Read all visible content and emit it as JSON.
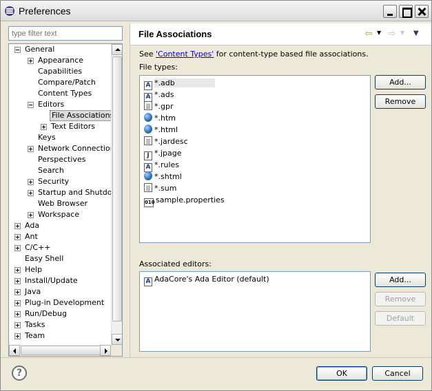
{
  "window": {
    "title": "Preferences"
  },
  "filter": {
    "placeholder": "type filter text"
  },
  "tree": [
    {
      "label": "General",
      "expander": "minus",
      "depth": 0
    },
    {
      "label": "Appearance",
      "expander": "plus",
      "depth": 1
    },
    {
      "label": "Capabilities",
      "expander": "none",
      "depth": 1
    },
    {
      "label": "Compare/Patch",
      "expander": "none",
      "depth": 1
    },
    {
      "label": "Content Types",
      "expander": "none",
      "depth": 1
    },
    {
      "label": "Editors",
      "expander": "minus",
      "depth": 1
    },
    {
      "label": "File Associations",
      "expander": "none",
      "depth": 2,
      "selected": true
    },
    {
      "label": "Text Editors",
      "expander": "plus",
      "depth": 2
    },
    {
      "label": "Keys",
      "expander": "none",
      "depth": 1
    },
    {
      "label": "Network Connections",
      "expander": "plus",
      "depth": 1
    },
    {
      "label": "Perspectives",
      "expander": "none",
      "depth": 1
    },
    {
      "label": "Search",
      "expander": "none",
      "depth": 1
    },
    {
      "label": "Security",
      "expander": "plus",
      "depth": 1
    },
    {
      "label": "Startup and Shutdown",
      "expander": "plus",
      "depth": 1
    },
    {
      "label": "Web Browser",
      "expander": "none",
      "depth": 1
    },
    {
      "label": "Workspace",
      "expander": "plus",
      "depth": 1
    },
    {
      "label": "Ada",
      "expander": "plus",
      "depth": 0
    },
    {
      "label": "Ant",
      "expander": "plus",
      "depth": 0
    },
    {
      "label": "C/C++",
      "expander": "plus",
      "depth": 0
    },
    {
      "label": "Easy Shell",
      "expander": "none",
      "depth": 0
    },
    {
      "label": "Help",
      "expander": "plus",
      "depth": 0
    },
    {
      "label": "Install/Update",
      "expander": "plus",
      "depth": 0
    },
    {
      "label": "Java",
      "expander": "plus",
      "depth": 0
    },
    {
      "label": "Plug-in Development",
      "expander": "plus",
      "depth": 0
    },
    {
      "label": "Run/Debug",
      "expander": "plus",
      "depth": 0
    },
    {
      "label": "Tasks",
      "expander": "plus",
      "depth": 0
    },
    {
      "label": "Team",
      "expander": "plus",
      "depth": 0
    }
  ],
  "page": {
    "title": "File Associations",
    "see_prefix": "See ",
    "see_link": "'Content Types'",
    "see_suffix": " for content-type based file associations.",
    "file_types_label": "File types:",
    "associated_editors_label": "Associated editors:"
  },
  "file_types": [
    {
      "name": "*.adb",
      "icon": "ada-icon",
      "glyph": "A",
      "selected": true
    },
    {
      "name": "*.ads",
      "icon": "ada-icon",
      "glyph": "A"
    },
    {
      "name": "*.gpr",
      "icon": "text-file-icon",
      "glyph": ""
    },
    {
      "name": "*.htm",
      "icon": "globe-icon",
      "glyph": ""
    },
    {
      "name": "*.html",
      "icon": "globe-icon",
      "glyph": ""
    },
    {
      "name": "*.jardesc",
      "icon": "jar-icon",
      "glyph": ""
    },
    {
      "name": "*.jpage",
      "icon": "java-page-icon",
      "glyph": "J"
    },
    {
      "name": "*.rules",
      "icon": "ada-icon",
      "glyph": "A"
    },
    {
      "name": "*.shtml",
      "icon": "globe-icon",
      "glyph": ""
    },
    {
      "name": "*.sum",
      "icon": "text-file-icon",
      "glyph": ""
    },
    {
      "name": "sample.properties",
      "icon": "binary-file-icon",
      "glyph": "010"
    }
  ],
  "editors": [
    {
      "name": "AdaCore's Ada Editor (default)",
      "icon": "ada-icon",
      "glyph": "A"
    }
  ],
  "buttons": {
    "add_file_type": "Add...",
    "remove_file_type": "Remove",
    "add_editor": "Add...",
    "remove_editor": "Remove",
    "default_editor": "Default",
    "ok": "OK",
    "cancel": "Cancel"
  },
  "icons": {
    "back": "back-arrow-icon",
    "forward": "forward-arrow-icon",
    "menu": "view-menu-icon",
    "help": "help-icon"
  }
}
